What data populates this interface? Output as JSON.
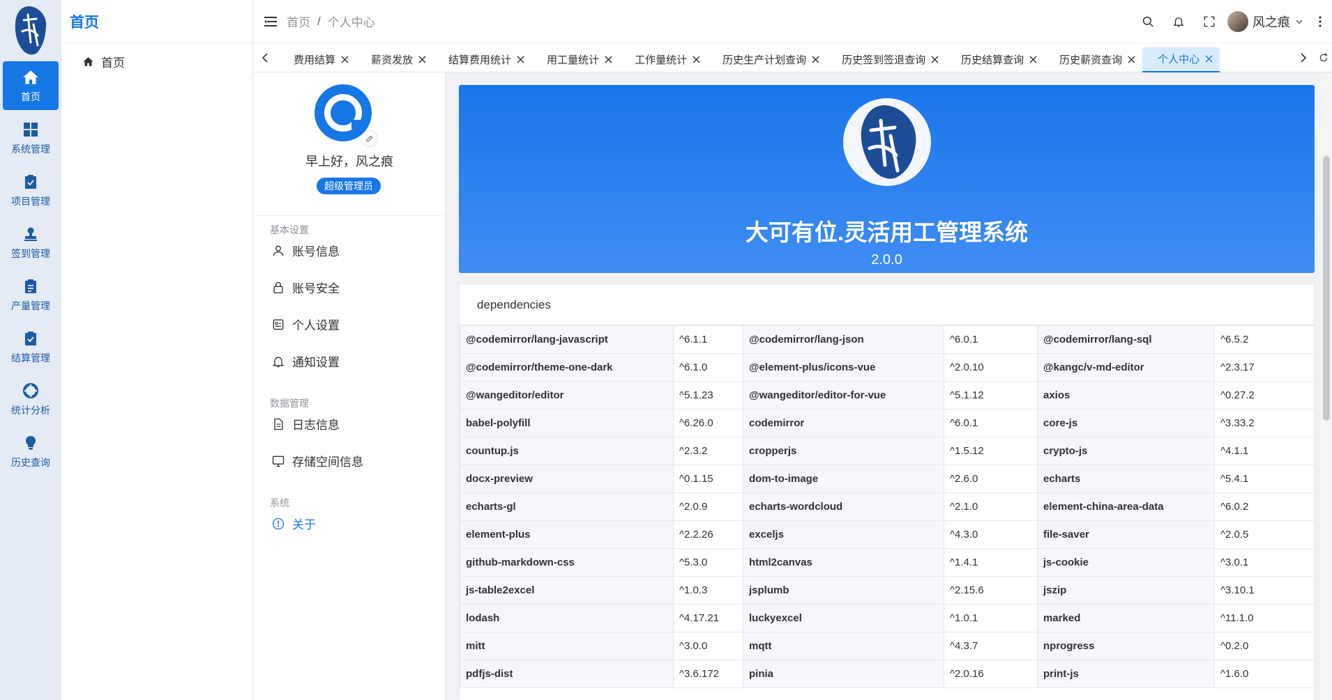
{
  "rail": {
    "items": [
      {
        "label": "首页",
        "icon": "home-icon",
        "active": true
      },
      {
        "label": "系统管理",
        "icon": "grid-icon"
      },
      {
        "label": "项目管理",
        "icon": "clipboard-check-icon"
      },
      {
        "label": "签到管理",
        "icon": "stamp-icon"
      },
      {
        "label": "产量管理",
        "icon": "clipboard-list-icon"
      },
      {
        "label": "结算管理",
        "icon": "clipboard-check-icon"
      },
      {
        "label": "统计分析",
        "icon": "lifebuoy-icon"
      },
      {
        "label": "历史查询",
        "icon": "bulb-icon"
      }
    ]
  },
  "sidebar": {
    "title": "首页",
    "items": [
      {
        "label": "首页",
        "icon": "home-icon"
      }
    ]
  },
  "header": {
    "breadcrumb": [
      "首页",
      "个人中心"
    ],
    "breadcrumb_sep": "/",
    "username": "风之痕"
  },
  "tabs": [
    {
      "label": "费用结算"
    },
    {
      "label": "薪资发放"
    },
    {
      "label": "结算费用统计"
    },
    {
      "label": "用工量统计"
    },
    {
      "label": "工作量统计"
    },
    {
      "label": "历史生产计划查询"
    },
    {
      "label": "历史签到签退查询"
    },
    {
      "label": "历史结算查询"
    },
    {
      "label": "历史薪资查询"
    },
    {
      "label": "个人中心",
      "active": true
    }
  ],
  "profile": {
    "greeting": "早上好，风之痕",
    "role": "超级管理员",
    "sections": [
      {
        "title": "基本设置",
        "items": [
          {
            "label": "账号信息",
            "icon": "user-icon"
          },
          {
            "label": "账号安全",
            "icon": "lock-icon"
          },
          {
            "label": "个人设置",
            "icon": "settings-panel-icon"
          },
          {
            "label": "通知设置",
            "icon": "bell-icon"
          }
        ]
      },
      {
        "title": "数据管理",
        "items": [
          {
            "label": "日志信息",
            "icon": "document-icon"
          },
          {
            "label": "存储空间信息",
            "icon": "monitor-icon"
          }
        ]
      },
      {
        "title": "系统",
        "items": [
          {
            "label": "关于",
            "icon": "info-icon",
            "active": true
          }
        ]
      }
    ]
  },
  "about": {
    "title": "大可有位.灵活用工管理系统",
    "version": "2.0.0",
    "dependencies_title": "dependencies",
    "dependencies": [
      [
        "@codemirror/lang-javascript",
        "^6.1.1",
        "@codemirror/lang-json",
        "^6.0.1",
        "@codemirror/lang-sql",
        "^6.5.2"
      ],
      [
        "@codemirror/theme-one-dark",
        "^6.1.0",
        "@element-plus/icons-vue",
        "^2.0.10",
        "@kangc/v-md-editor",
        "^2.3.17"
      ],
      [
        "@wangeditor/editor",
        "^5.1.23",
        "@wangeditor/editor-for-vue",
        "^5.1.12",
        "axios",
        "^0.27.2"
      ],
      [
        "babel-polyfill",
        "^6.26.0",
        "codemirror",
        "^6.0.1",
        "core-js",
        "^3.33.2"
      ],
      [
        "countup.js",
        "^2.3.2",
        "cropperjs",
        "^1.5.12",
        "crypto-js",
        "^4.1.1"
      ],
      [
        "docx-preview",
        "^0.1.15",
        "dom-to-image",
        "^2.6.0",
        "echarts",
        "^5.4.1"
      ],
      [
        "echarts-gl",
        "^2.0.9",
        "echarts-wordcloud",
        "^2.1.0",
        "element-china-area-data",
        "^6.0.2"
      ],
      [
        "element-plus",
        "^2.2.26",
        "exceljs",
        "^4.3.0",
        "file-saver",
        "^2.0.5"
      ],
      [
        "github-markdown-css",
        "^5.3.0",
        "html2canvas",
        "^1.4.1",
        "js-cookie",
        "^3.0.1"
      ],
      [
        "js-table2excel",
        "^1.0.3",
        "jsplumb",
        "^2.15.6",
        "jszip",
        "^3.10.1"
      ],
      [
        "lodash",
        "^4.17.21",
        "luckyexcel",
        "^1.0.1",
        "marked",
        "^11.1.0"
      ],
      [
        "mitt",
        "^3.0.0",
        "mqtt",
        "^4.3.7",
        "nprogress",
        "^0.2.0"
      ],
      [
        "pdfjs-dist",
        "^3.6.172",
        "pinia",
        "^2.0.16",
        "print-js",
        "^1.6.0"
      ]
    ]
  },
  "colors": {
    "primary": "#1677e6",
    "rail_bg": "#e4ebf5",
    "banner_top": "#1976ea"
  }
}
